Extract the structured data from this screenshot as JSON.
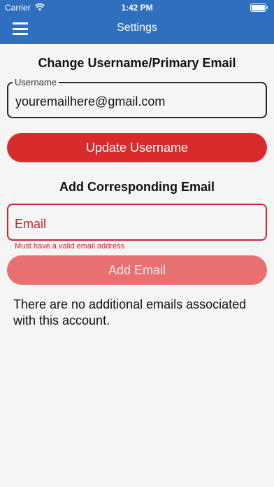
{
  "status_bar": {
    "carrier": "Carrier",
    "time": "1:42 PM"
  },
  "nav": {
    "title": "Settings",
    "menu_icon": "hamburger-menu-icon"
  },
  "change_section": {
    "title": "Change Username/Primary Email",
    "username_label": "Username",
    "username_value": "youremailhere@gmail.com",
    "button_label": "Update Username"
  },
  "add_section": {
    "title": "Add Corresponding Email",
    "email_placeholder": "Email",
    "error_text": "Must have a valid email address",
    "button_label": "Add Email"
  },
  "info_text": "There are no additional emails associated with this account.",
  "colors": {
    "header": "#2f6fbd",
    "primary_red": "#d92b2b",
    "disabled_red": "#e87070",
    "error_red": "#c9252d"
  }
}
